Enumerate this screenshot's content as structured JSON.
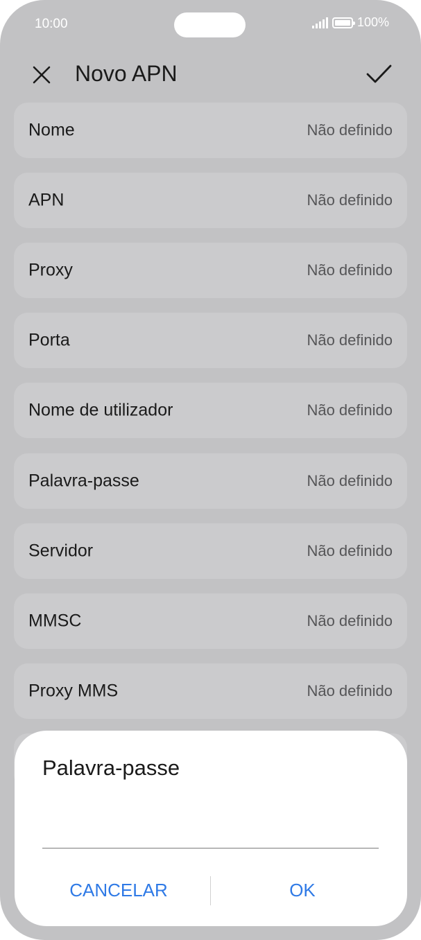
{
  "status_bar": {
    "time": "10:00",
    "battery": "100%"
  },
  "header": {
    "title": "Novo APN"
  },
  "rows": [
    {
      "label": "Nome",
      "value": "Não definido"
    },
    {
      "label": "APN",
      "value": "Não definido"
    },
    {
      "label": "Proxy",
      "value": "Não definido"
    },
    {
      "label": "Porta",
      "value": "Não definido"
    },
    {
      "label": "Nome de utilizador",
      "value": "Não definido"
    },
    {
      "label": "Palavra-passe",
      "value": "Não definido"
    },
    {
      "label": "Servidor",
      "value": "Não definido"
    },
    {
      "label": "MMSC",
      "value": "Não definido"
    },
    {
      "label": "Proxy MMS",
      "value": "Não definido"
    }
  ],
  "dialog": {
    "title": "Palavra-passe",
    "input_value": "",
    "cancel_label": "CANCELAR",
    "ok_label": "OK"
  },
  "colors": {
    "accent": "#2f7ae6",
    "background": "#c2c2c4",
    "row": "#cbcbcd"
  }
}
